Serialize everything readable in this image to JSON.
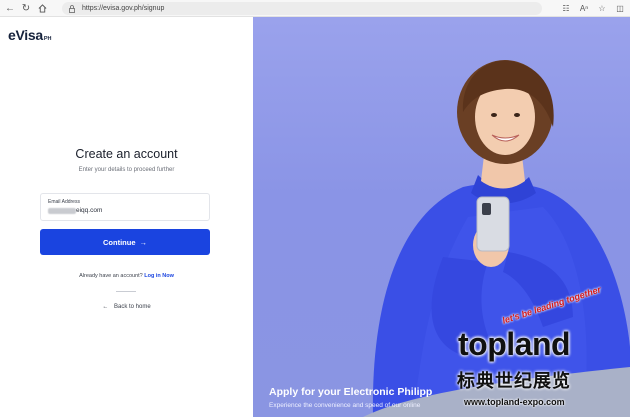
{
  "browser": {
    "url": "https://evisa.gov.ph/signup"
  },
  "logo": {
    "main": "eVisa",
    "sub": "PH"
  },
  "form": {
    "title": "Create an account",
    "subtitle": "Enter your details to proceed further",
    "email_label": "Email Address",
    "email_value": "eiqq.com",
    "continue_label": "Continue",
    "continue_arrow": "→",
    "login_prompt": "Already have an account?",
    "login_link": "Log in Now",
    "back_arrow": "←",
    "back_label": "Back to home"
  },
  "hero": {
    "title": "Apply for your Electronic Philipp",
    "subtitle": "Experience the convenience and speed of our online"
  },
  "watermark": {
    "tag": "let's be leading together",
    "brand": "topland",
    "cn": "标典世纪展览",
    "url": "www.topland-expo.com"
  },
  "colors": {
    "accent": "#1a44e0",
    "hero_bg": "#8c95e8",
    "sweater": "#3a4fe6"
  },
  "icons": [
    "back-icon",
    "refresh-icon",
    "home-icon",
    "lock-icon",
    "reader-icon",
    "font-icon",
    "favorite-icon",
    "split-icon",
    "arrow-right-icon",
    "arrow-left-icon"
  ]
}
